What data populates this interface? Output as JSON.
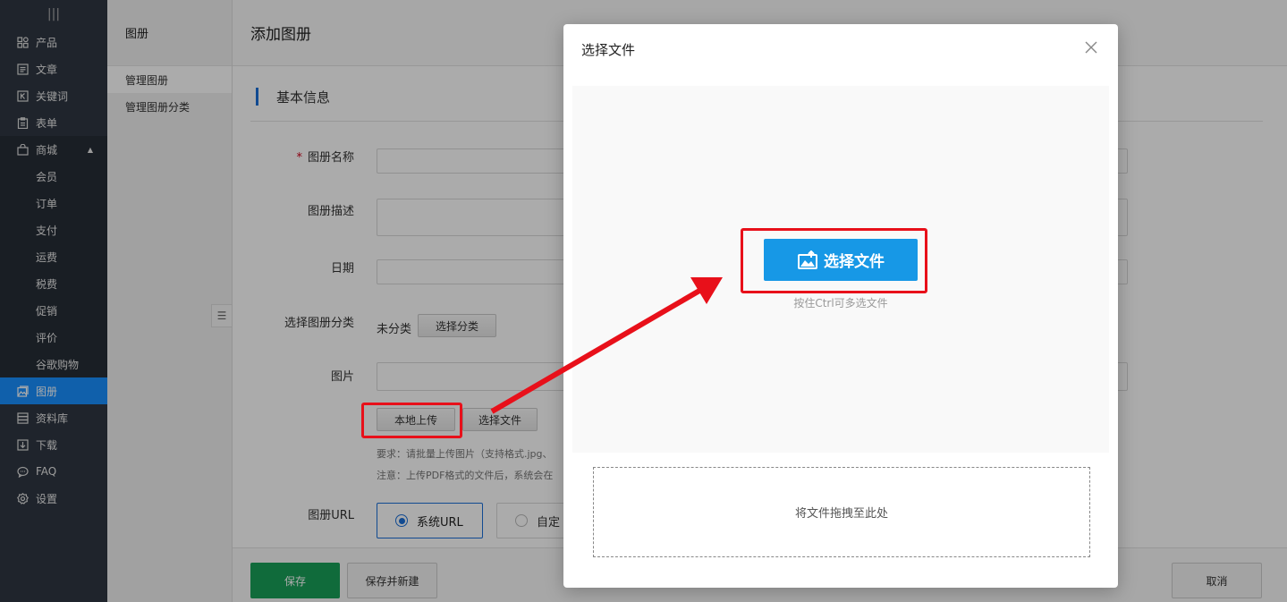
{
  "sidebar": {
    "handle": "|||",
    "items": [
      {
        "label": "产品",
        "icon": "grid-icon"
      },
      {
        "label": "文章",
        "icon": "article-icon"
      },
      {
        "label": "关键词",
        "icon": "keyword-icon"
      },
      {
        "label": "表单",
        "icon": "form-icon"
      },
      {
        "label": "商城",
        "icon": "shop-bag-icon"
      },
      {
        "label": "会员"
      },
      {
        "label": "订单"
      },
      {
        "label": "支付"
      },
      {
        "label": "运费"
      },
      {
        "label": "税费"
      },
      {
        "label": "促销"
      },
      {
        "label": "评价"
      },
      {
        "label": "谷歌购物"
      },
      {
        "label": "图册",
        "icon": "album-icon"
      },
      {
        "label": "资料库",
        "icon": "database-icon"
      },
      {
        "label": "下载",
        "icon": "download-icon"
      },
      {
        "label": "FAQ",
        "icon": "faq-icon"
      },
      {
        "label": "设置",
        "icon": "settings-icon"
      }
    ],
    "active_color": "#1890ff"
  },
  "subnav": {
    "title": "图册",
    "links": [
      "管理图册",
      "管理图册分类"
    ]
  },
  "main": {
    "page_title": "添加图册",
    "section_title": "基本信息",
    "fields": {
      "name_label": "图册名称",
      "desc_label": "图册描述",
      "date_label": "日期",
      "category_label": "选择图册分类",
      "category_value": "未分类",
      "category_button": "选择分类",
      "image_label": "图片",
      "local_upload_button": "本地上传",
      "choose_file_button": "选择文件",
      "hint1": "要求：请批量上传图片（支持格式.jpg、",
      "hint2": "注意：上传PDF格式的文件后，系统会在",
      "url_label": "图册URL",
      "url_option_system": "系统URL",
      "url_option_custom": "自定"
    },
    "footer": {
      "save": "保存",
      "save_new": "保存并新建",
      "cancel": "取消"
    }
  },
  "modal": {
    "title": "选择文件",
    "pick_button": "选择文件",
    "pick_hint": "按住Ctrl可多选文件",
    "dropzone": "将文件拖拽至此处",
    "accent": "#1798e6"
  },
  "annotation": {
    "color": "#e8101a"
  }
}
